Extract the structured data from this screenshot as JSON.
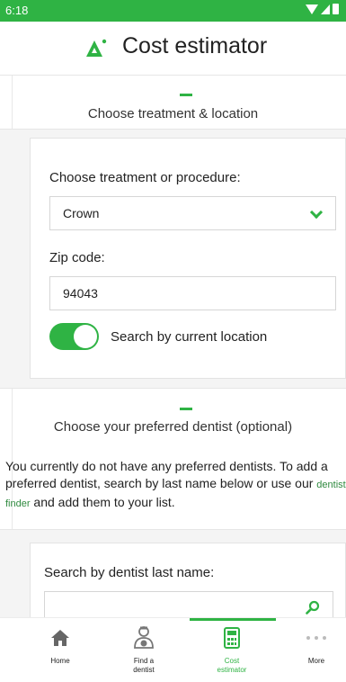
{
  "status": {
    "time": "6:18"
  },
  "header": {
    "title": "Cost estimator"
  },
  "section1": {
    "heading": "Choose treatment & location",
    "procedure_label": "Choose treatment or procedure:",
    "procedure_value": "Crown",
    "zip_label": "Zip code:",
    "zip_value": "94043",
    "location_toggle_label": "Search by current location",
    "location_toggle_on": true
  },
  "section2": {
    "heading": "Choose your preferred dentist (optional)",
    "info_before": "You currently do not have any preferred dentists. To add a preferred dentist, search by last name below or use our ",
    "info_link": "dentist finder",
    "info_after": " and add them to your list.",
    "search_label": "Search by dentist last name:",
    "search_value": ""
  },
  "nav": {
    "items": [
      {
        "label": "Home",
        "icon": "home-icon"
      },
      {
        "label": "Find a\ndentist",
        "icon": "dentist-icon"
      },
      {
        "label": "Cost\nestimator",
        "icon": "calculator-icon",
        "active": true
      },
      {
        "label": "More",
        "icon": "more-icon"
      }
    ]
  },
  "colors": {
    "accent": "#2fb344",
    "link": "#2f8a3f"
  }
}
